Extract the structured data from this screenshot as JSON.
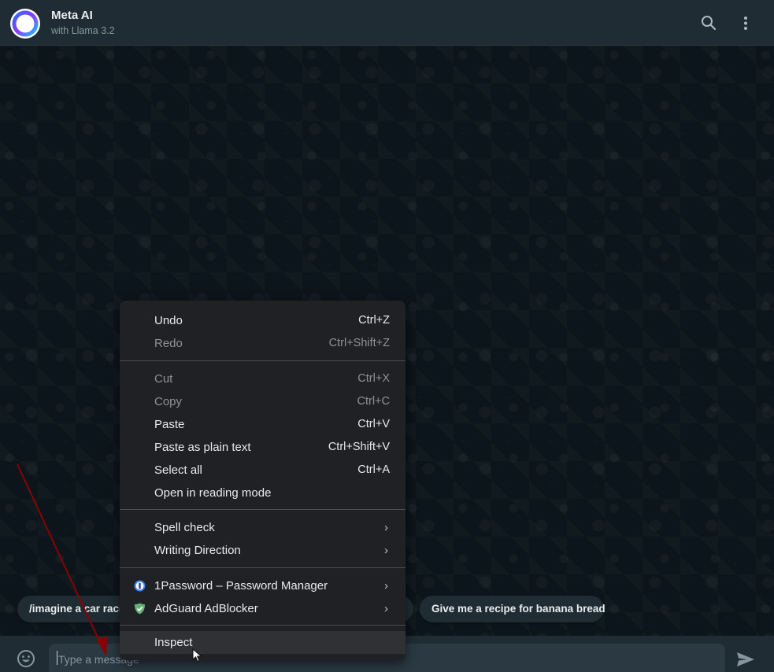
{
  "header": {
    "title": "Meta AI",
    "subtitle": "with Llama 3.2",
    "icons": [
      "search-icon",
      "more-vertical-icon"
    ]
  },
  "suggestions": [
    {
      "label": "/imagine a car race"
    },
    {
      "label": ""
    },
    {
      "label": "Give me a recipe for banana bread"
    }
  ],
  "composer": {
    "placeholder": "Type a message",
    "icons": [
      "emoji-icon",
      "send-icon"
    ]
  },
  "context_menu": {
    "items": [
      {
        "label": "Undo",
        "shortcut": "Ctrl+Z",
        "enabled": true
      },
      {
        "label": "Redo",
        "shortcut": "Ctrl+Shift+Z",
        "enabled": false
      },
      {
        "label": "Cut",
        "shortcut": "Ctrl+X",
        "enabled": false
      },
      {
        "label": "Copy",
        "shortcut": "Ctrl+C",
        "enabled": false
      },
      {
        "label": "Paste",
        "shortcut": "Ctrl+V",
        "enabled": true
      },
      {
        "label": "Paste as plain text",
        "shortcut": "Ctrl+Shift+V",
        "enabled": true
      },
      {
        "label": "Select all",
        "shortcut": "Ctrl+A",
        "enabled": true
      },
      {
        "label": "Open in reading mode",
        "shortcut": "",
        "enabled": true
      },
      {
        "label": "Spell check",
        "submenu": true
      },
      {
        "label": "Writing Direction",
        "submenu": true
      },
      {
        "label": "1Password – Password Manager",
        "submenu": true,
        "icon": "1password-icon"
      },
      {
        "label": "AdGuard AdBlocker",
        "submenu": true,
        "icon": "adguard-shield-icon"
      },
      {
        "label": "Inspect",
        "highlighted": true
      }
    ],
    "submenu_arrow": "›"
  },
  "colors": {
    "header_bg": "#202c33",
    "chat_bg": "#0b141a",
    "menu_bg": "#202124",
    "annotation_arrow": "#8b0000"
  }
}
